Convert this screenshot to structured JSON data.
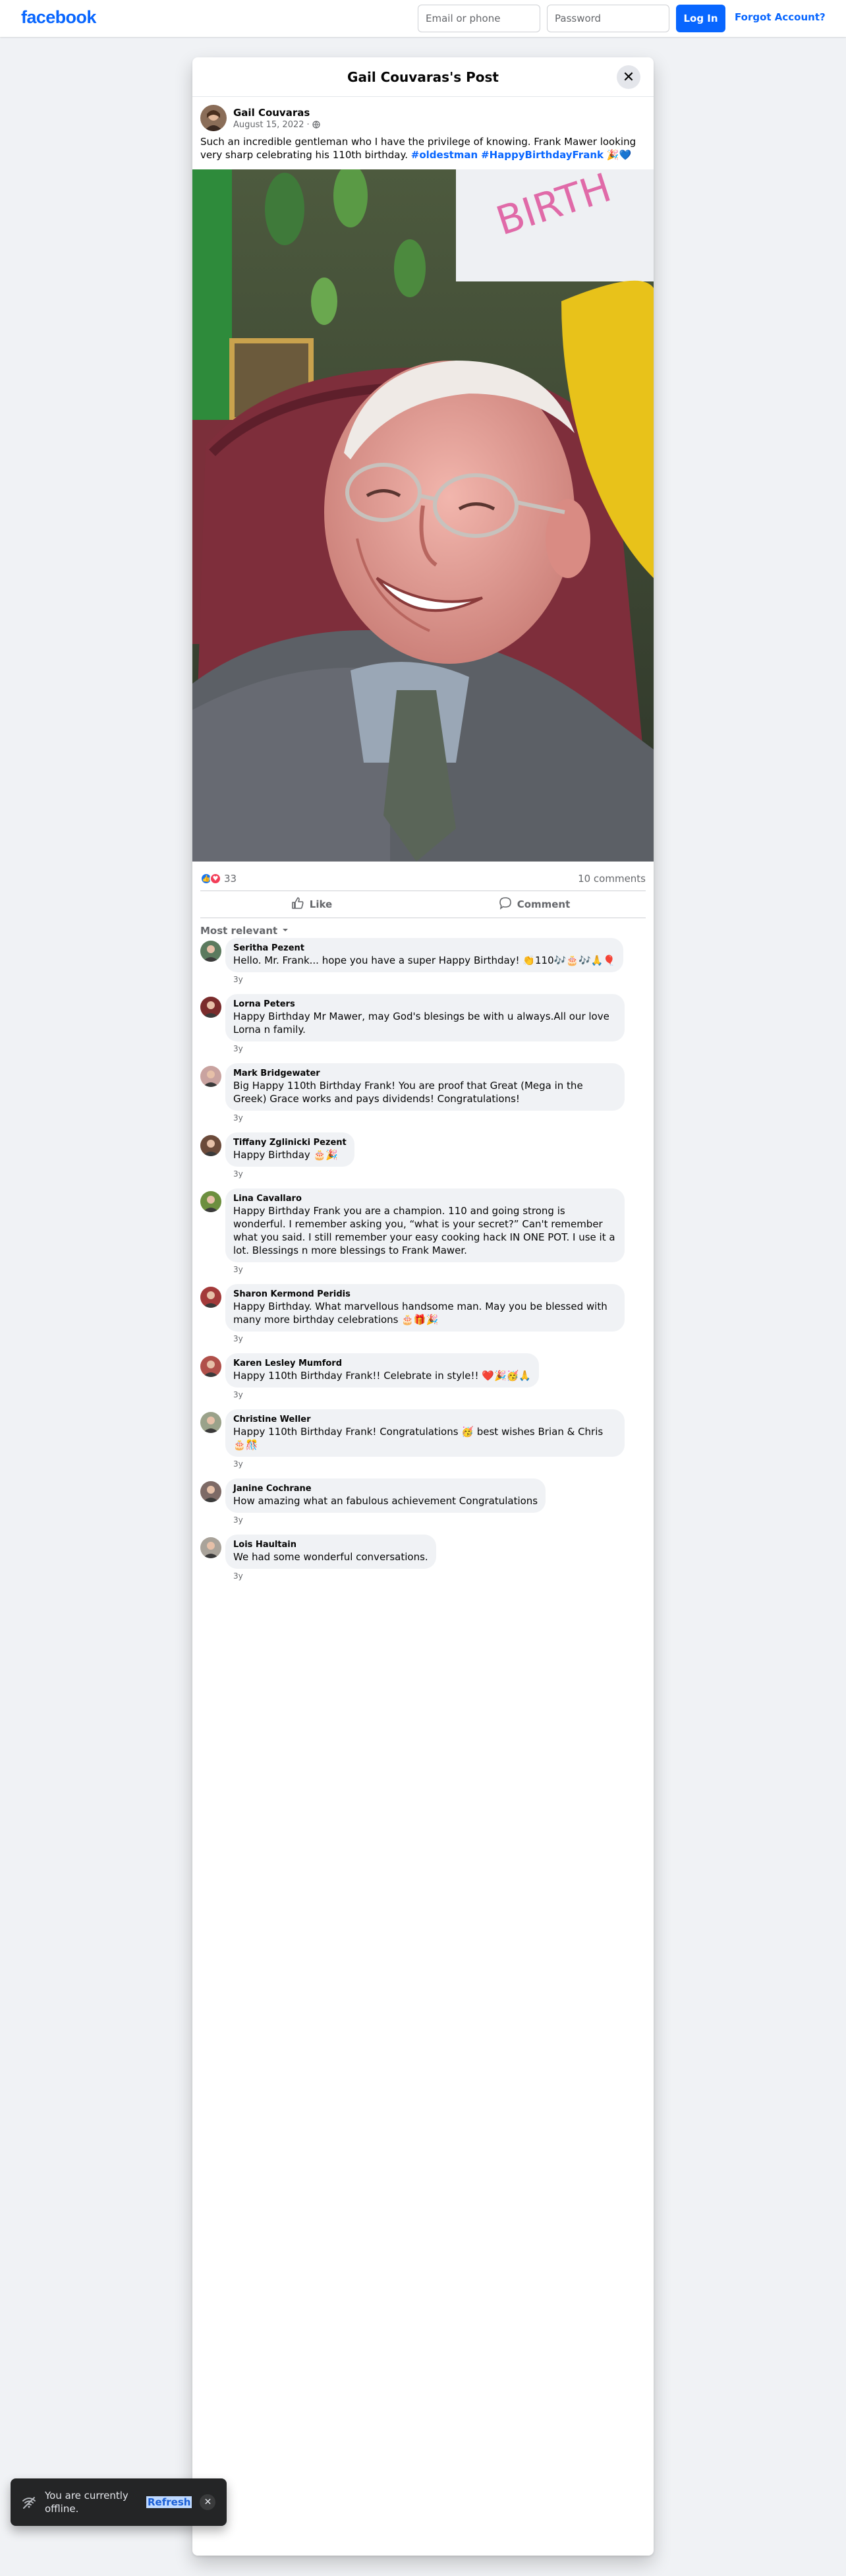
{
  "nav": {
    "logo": "facebook",
    "email_placeholder": "Email or phone",
    "password_placeholder": "Password",
    "login_label": "Log In",
    "forgot_label": "Forgot Account?"
  },
  "modal": {
    "title": "Gail Couvaras's Post",
    "close_icon": "close-icon"
  },
  "post": {
    "author": "Gail Couvaras",
    "date": "August 15, 2022",
    "audience_icon": "globe-icon",
    "text": "Such an incredible gentleman who I have the privilege of knowing. Frank Mawer looking very sharp celebrating his 110th birthday.",
    "hashtag1": "#oldestman",
    "hashtag2": "#HappyBirthdayFrank",
    "emoji_tail": "🎉💙",
    "reaction_count": "33",
    "comment_count": "10 comments",
    "like_label": "Like",
    "comment_label": "Comment",
    "sort_label": "Most relevant"
  },
  "comments": [
    {
      "name": "Seritha Pezent",
      "text": "Hello. Mr. Frank... hope you have a super Happy Birthday! 👏110🎶🎂🎶🙏🎈",
      "time": "3y",
      "color": "#5b7a5e"
    },
    {
      "name": "Lorna Peters",
      "text": "Happy Birthday Mr Mawer, may God's blesings be with u always.All our love Lorna n family.",
      "time": "3y",
      "color": "#7a2c2c"
    },
    {
      "name": "Mark Bridgewater",
      "text": "Big Happy 110th Birthday Frank! You are proof that Great (Mega in the Greek) Grace works and pays dividends! Congratulations!",
      "time": "3y",
      "color": "#c9a3a0"
    },
    {
      "name": "Tiffany Zglinicki Pezent",
      "text": "Happy Birthday 🎂🎉",
      "time": "3y",
      "color": "#6b4a3a"
    },
    {
      "name": "Lina Cavallaro",
      "text": "Happy Birthday Frank you are a champion. 110 and going strong is wonderful. I remember asking you, “what is your secret?” Can't remember what you said. I still remember your easy cooking hack IN ONE POT. I use it a lot. Blessings n more blessings to Frank Mawer.",
      "time": "3y",
      "color": "#6c8f3f"
    },
    {
      "name": "Sharon Kermond Peridis",
      "text": "Happy Birthday. What marvellous handsome man. May you be blessed with many more birthday celebrations 🎂🎁🎉",
      "time": "3y",
      "color": "#a33a3a"
    },
    {
      "name": "Karen Lesley Mumford",
      "text": "Happy 110th Birthday Frank!! Celebrate in style!! ❤️🎉🥳🙏",
      "time": "3y",
      "color": "#b0504a"
    },
    {
      "name": "Christine Weller",
      "text": "Happy 110th Birthday Frank! Congratulations 🥳 best wishes Brian & Chris 🎂🎊",
      "time": "3y",
      "color": "#9aa28a"
    },
    {
      "name": "Janine Cochrane",
      "text": "How amazing what an fabulous achievement Congratulations",
      "time": "3y",
      "color": "#7d6a66"
    },
    {
      "name": "Lois Haultain",
      "text": "We had some wonderful conversations.",
      "time": "3y",
      "color": "#a9a39a"
    }
  ],
  "toast": {
    "text": "You are currently offline.",
    "refresh_label": "Refresh",
    "icon": "wifi-off-icon"
  }
}
